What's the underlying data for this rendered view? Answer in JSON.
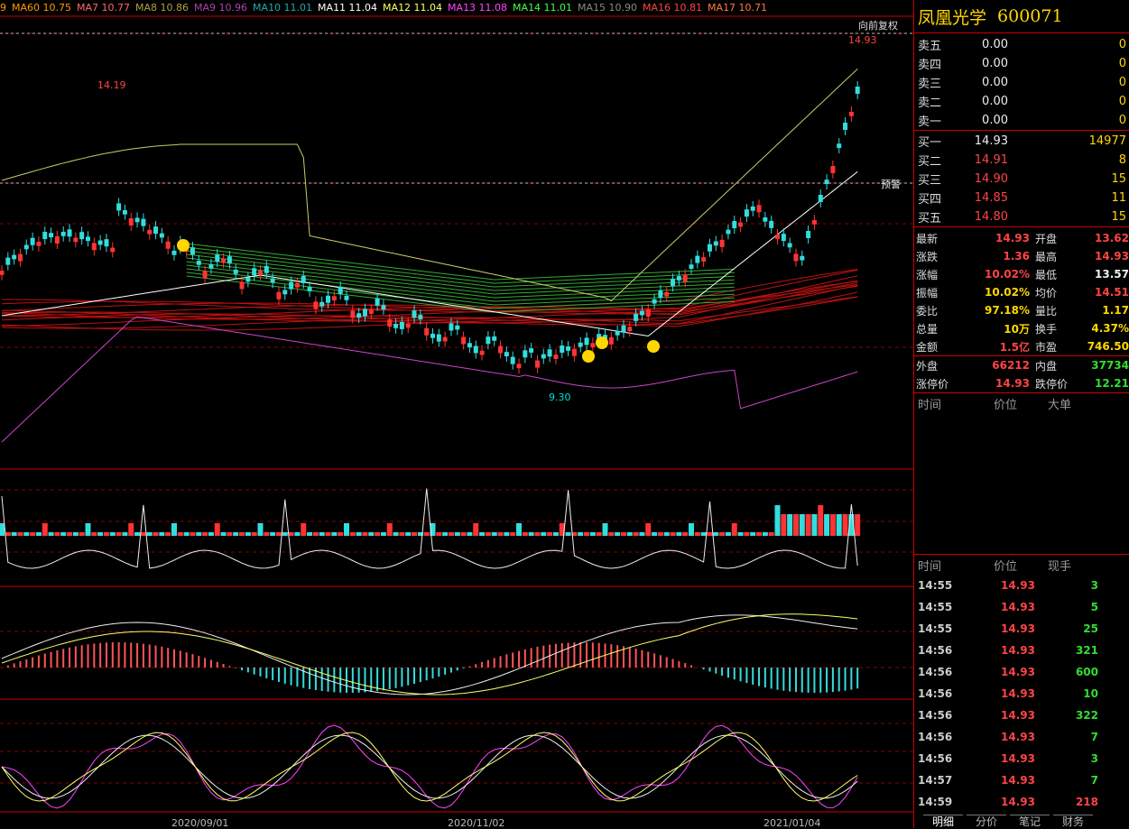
{
  "stock": {
    "name": "凤凰光学",
    "code": "600071"
  },
  "chart": {
    "restore_label": "向前复权",
    "ma_labels": [
      {
        "t": "9",
        "c": "#ff9900"
      },
      {
        "t": "MA60 10.75",
        "c": "#ff9900"
      },
      {
        "t": "MA7 10.77",
        "c": "#ff6666"
      },
      {
        "t": "MA8 10.86",
        "c": "#b0a040"
      },
      {
        "t": "MA9 10.96",
        "c": "#aa44aa"
      },
      {
        "t": "MA10 11.01",
        "c": "#22aaaa"
      },
      {
        "t": "MA11 11.04",
        "c": "#ffffff"
      },
      {
        "t": "MA12 11.04",
        "c": "#ffff66"
      },
      {
        "t": "MA13 11.08",
        "c": "#ff44ff"
      },
      {
        "t": "MA14 11.01",
        "c": "#44ff44"
      },
      {
        "t": "MA15 10.90",
        "c": "#888888"
      },
      {
        "t": "MA16 10.81",
        "c": "#ff4444"
      },
      {
        "t": "MA17 10.71",
        "c": "#ff7744"
      }
    ],
    "high_label": "14.19",
    "low_label": "9.30",
    "last_high_label": "14.93",
    "warn_label": "预警",
    "x_axis": [
      "2020/09/01",
      "2020/11/02",
      "2021/01/04"
    ]
  },
  "sell_levels": [
    {
      "label": "卖五",
      "price": "0.00",
      "vol": "0"
    },
    {
      "label": "卖四",
      "price": "0.00",
      "vol": "0"
    },
    {
      "label": "卖三",
      "price": "0.00",
      "vol": "0"
    },
    {
      "label": "卖二",
      "price": "0.00",
      "vol": "0"
    },
    {
      "label": "卖一",
      "price": "0.00",
      "vol": "0"
    }
  ],
  "buy_levels": [
    {
      "label": "买一",
      "price": "14.93",
      "vol": "14977"
    },
    {
      "label": "买二",
      "price": "14.91",
      "vol": "8"
    },
    {
      "label": "买三",
      "price": "14.90",
      "vol": "15"
    },
    {
      "label": "买四",
      "price": "14.85",
      "vol": "11"
    },
    {
      "label": "买五",
      "price": "14.80",
      "vol": "15"
    }
  ],
  "quote": [
    {
      "l1": "最新",
      "v1": "14.93",
      "c1": "red",
      "l2": "开盘",
      "v2": "13.62",
      "c2": "red"
    },
    {
      "l1": "涨跌",
      "v1": "1.36",
      "c1": "red",
      "l2": "最高",
      "v2": "14.93",
      "c2": "red"
    },
    {
      "l1": "涨幅",
      "v1": "10.02%",
      "c1": "red",
      "l2": "最低",
      "v2": "13.57",
      "c2": "white"
    },
    {
      "l1": "振幅",
      "v1": "10.02%",
      "c1": "yellow",
      "l2": "均价",
      "v2": "14.51",
      "c2": "red"
    },
    {
      "l1": "委比",
      "v1": "97.18%",
      "c1": "yellow",
      "l2": "量比",
      "v2": "1.17",
      "c2": "yellow"
    },
    {
      "l1": "总量",
      "v1": "10万",
      "c1": "yellow",
      "l2": "换手",
      "v2": "4.37%",
      "c2": "yellow"
    },
    {
      "l1": "金额",
      "v1": "1.5亿",
      "c1": "red",
      "l2": "市盈",
      "v2": "746.50",
      "c2": "yellow"
    }
  ],
  "flow": [
    {
      "l1": "外盘",
      "v1": "66212",
      "c1": "red",
      "l2": "内盘",
      "v2": "37734",
      "c2": "green"
    },
    {
      "l1": "涨停价",
      "v1": "14.93",
      "c1": "red",
      "l2": "跌停价",
      "v2": "12.21",
      "c2": "green"
    }
  ],
  "big_order_header": {
    "time": "时间",
    "price": "价位",
    "size": "大单"
  },
  "tick_header": {
    "time": "时间",
    "price": "价位",
    "size": "现手"
  },
  "ticks": [
    {
      "time": "14:55",
      "price": "14.93",
      "vol": "3",
      "up": false
    },
    {
      "time": "14:55",
      "price": "14.93",
      "vol": "5",
      "up": false
    },
    {
      "time": "14:55",
      "price": "14.93",
      "vol": "25",
      "up": false
    },
    {
      "time": "14:56",
      "price": "14.93",
      "vol": "321",
      "up": false
    },
    {
      "time": "14:56",
      "price": "14.93",
      "vol": "600",
      "up": false
    },
    {
      "time": "14:56",
      "price": "14.93",
      "vol": "10",
      "up": false
    },
    {
      "time": "14:56",
      "price": "14.93",
      "vol": "322",
      "up": false
    },
    {
      "time": "14:56",
      "price": "14.93",
      "vol": "7",
      "up": false
    },
    {
      "time": "14:56",
      "price": "14.93",
      "vol": "3",
      "up": false
    },
    {
      "time": "14:57",
      "price": "14.93",
      "vol": "7",
      "up": false
    },
    {
      "time": "14:59",
      "price": "14.93",
      "vol": "218",
      "up": true
    }
  ],
  "tabs": [
    "明细",
    "分价",
    "笔记",
    "财务"
  ],
  "colors": {
    "up": "#ff3333",
    "down": "#33dddd",
    "border": "#cc0000",
    "gold": "#ffd700"
  }
}
